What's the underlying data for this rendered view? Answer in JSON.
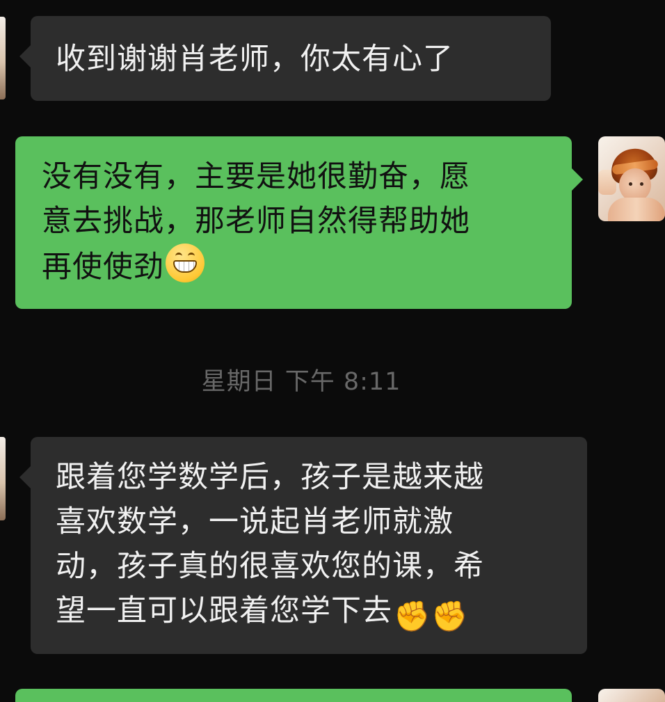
{
  "messages": [
    {
      "direction": "in",
      "text": "收到谢谢肖老师，你太有心了"
    },
    {
      "direction": "out",
      "text": "没有没有，主要是她很勤奋，愿\n意去挑战，那老师自然得帮助她\n再使使劲",
      "emoji": "grinning-face"
    },
    {
      "type": "timestamp",
      "text": "星期日 下午 8:11"
    },
    {
      "direction": "in",
      "text": "跟着您学数学后，孩子是越来越\n喜欢数学，一说起肖老师就激\n动，孩子真的很喜欢您的课，希\n望一直可以跟着您学下去",
      "emojis": [
        "raised-fist",
        "raised-fist"
      ]
    },
    {
      "direction": "out",
      "text": ""
    }
  ],
  "icons": {
    "grin": "grinning-face",
    "fist": "raised-fist"
  }
}
